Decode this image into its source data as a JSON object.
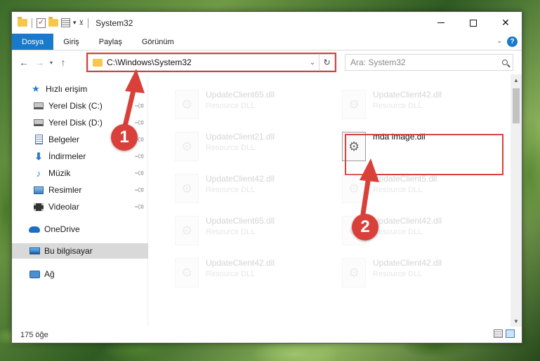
{
  "window": {
    "title": "System32"
  },
  "ribbon": {
    "tabs": [
      "Dosya",
      "Giriş",
      "Paylaş",
      "Görünüm"
    ]
  },
  "address": {
    "path": "C:\\Windows\\System32"
  },
  "search": {
    "placeholder": "Ara: System32"
  },
  "nav": {
    "items": [
      {
        "label": "Hızlı erişim",
        "icon": "star-icon"
      },
      {
        "label": "Yerel Disk (C:)",
        "icon": "drive-icon"
      },
      {
        "label": "Yerel Disk (D:)",
        "icon": "drive-icon"
      },
      {
        "label": "Belgeler",
        "icon": "documents-icon"
      },
      {
        "label": "İndirmeler",
        "icon": "downloads-icon"
      },
      {
        "label": "Müzik",
        "icon": "music-icon"
      },
      {
        "label": "Resimler",
        "icon": "pictures-icon"
      },
      {
        "label": "Videolar",
        "icon": "videos-icon"
      },
      {
        "label": "OneDrive",
        "icon": "onedrive-icon"
      },
      {
        "label": "Bu bilgisayar",
        "icon": "this-pc-icon"
      },
      {
        "label": "Ağ",
        "icon": "network-icon"
      }
    ]
  },
  "files": [
    {
      "name": "UpdateClient65.dll",
      "type": "Resource DLL"
    },
    {
      "name": "UpdateClient42.dll",
      "type": "Resource DLL"
    },
    {
      "name": "UpdateClient21.dll",
      "type": "Resource DLL"
    },
    {
      "name": "mda image.dll",
      "type": ""
    },
    {
      "name": "UpdateClient42.dll",
      "type": "Resource DLL"
    },
    {
      "name": "UpdateClient5.dll",
      "type": "Resource DLL"
    },
    {
      "name": "UpdateClient65.dll",
      "type": "Resource DLL"
    },
    {
      "name": "UpdateClient42.dll",
      "type": "Resource DLL"
    },
    {
      "name": "UpdateClient42.dll",
      "type": "Resource DLL"
    },
    {
      "name": "UpdateClient42.dll",
      "type": "Resource DLL"
    }
  ],
  "status": {
    "count": "175 öğe"
  },
  "annotations": {
    "step1": "1",
    "step2": "2",
    "color": "#d9403a"
  }
}
